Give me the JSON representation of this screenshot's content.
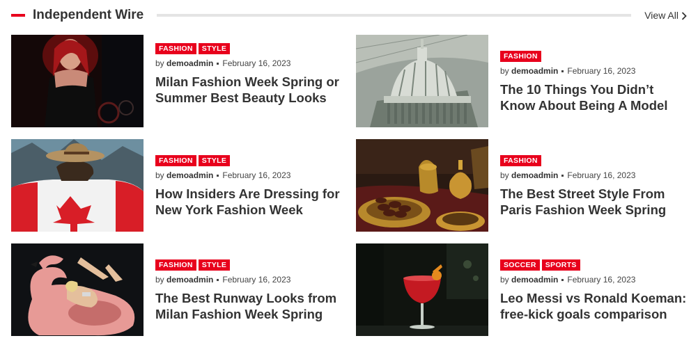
{
  "section": {
    "title": "Independent Wire",
    "view_all": "View All",
    "accent": "#e8001c"
  },
  "posts": [
    {
      "tags": [
        "FASHION",
        "STYLE"
      ],
      "by": "by",
      "author": "demoadmin",
      "date": "February 16, 2023",
      "title": "Milan Fashion Week Spring or Summer Best Beauty Looks",
      "image": "woman-in-black-dress-red-light"
    },
    {
      "tags": [
        "FASHION"
      ],
      "by": "by",
      "author": "demoadmin",
      "date": "February 16, 2023",
      "title": "The 10 Things You Didn’t Know About Being A Model",
      "image": "capitol-on-banknote"
    },
    {
      "tags": [
        "FASHION",
        "STYLE"
      ],
      "by": "by",
      "author": "demoadmin",
      "date": "February 16, 2023",
      "title": "How Insiders Are Dressing for New York Fashion Week",
      "image": "person-with-hat-canada-flag"
    },
    {
      "tags": [
        "FASHION"
      ],
      "by": "by",
      "author": "demoadmin",
      "date": "February 16, 2023",
      "title": "The Best Street Style From Paris Fashion Week Spring",
      "image": "dates-in-golden-tray"
    },
    {
      "tags": [
        "FASHION",
        "STYLE"
      ],
      "by": "by",
      "author": "demoadmin",
      "date": "February 16, 2023",
      "title": "The Best Runway Looks from Milan Fashion Week Spring",
      "image": "woman-on-pink-flamingo-float"
    },
    {
      "tags": [
        "SOCCER",
        "SPORTS"
      ],
      "by": "by",
      "author": "demoadmin",
      "date": "February 16, 2023",
      "title": "Leo Messi vs Ronald Koeman: free-kick goals comparison",
      "image": "red-cocktail-glass"
    }
  ]
}
